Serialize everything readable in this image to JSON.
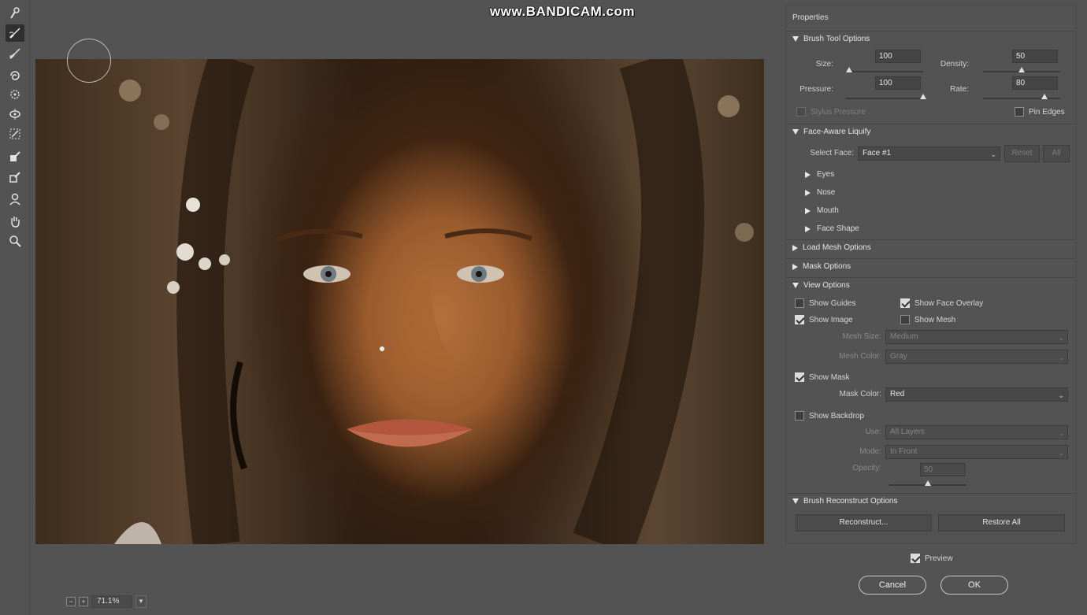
{
  "watermark": "www.BANDICAM.com",
  "toolbar": {
    "tools": [
      {
        "name": "forward-warp-icon",
        "active": false
      },
      {
        "name": "reconstruct-brush-icon",
        "active": true
      },
      {
        "name": "smooth-brush-icon",
        "active": false
      },
      {
        "name": "twirl-icon",
        "active": false
      },
      {
        "name": "pucker-icon",
        "active": false
      },
      {
        "name": "bloat-icon",
        "active": false
      },
      {
        "name": "push-left-icon",
        "active": false
      },
      {
        "name": "freeze-mask-icon",
        "active": false
      },
      {
        "name": "thaw-mask-icon",
        "active": false
      },
      {
        "name": "face-tool-icon",
        "active": false
      },
      {
        "name": "hand-icon",
        "active": false
      },
      {
        "name": "zoom-icon",
        "active": false
      }
    ]
  },
  "zoom": {
    "value": "71.1%"
  },
  "panel": {
    "title": "Properties",
    "brush_tool": {
      "heading": "Brush Tool Options",
      "size_label": "Size:",
      "size_value": "100",
      "size_level": 0.04,
      "density_label": "Density:",
      "density_value": "50",
      "density_level": 0.5,
      "pressure_label": "Pressure:",
      "pressure_value": "100",
      "pressure_level": 1.0,
      "rate_label": "Rate:",
      "rate_value": "80",
      "rate_level": 0.8,
      "stylus_label": "Stylus Pressure",
      "pin_edges_label": "Pin Edges"
    },
    "face_aware": {
      "heading": "Face-Aware Liquify",
      "select_face_label": "Select Face:",
      "select_face_value": "Face #1",
      "reset_label": "Reset",
      "all_label": "All",
      "items": [
        "Eyes",
        "Nose",
        "Mouth",
        "Face Shape"
      ]
    },
    "load_mesh_heading": "Load Mesh Options",
    "mask_heading": "Mask Options",
    "view": {
      "heading": "View Options",
      "show_guides": "Show Guides",
      "show_face_overlay": "Show Face Overlay",
      "show_image": "Show Image",
      "show_mesh": "Show Mesh",
      "mesh_size_label": "Mesh Size:",
      "mesh_size_value": "Medium",
      "mesh_color_label": "Mesh Color:",
      "mesh_color_value": "Gray",
      "show_mask": "Show Mask",
      "mask_color_label": "Mask Color:",
      "mask_color_value": "Red",
      "show_backdrop": "Show Backdrop",
      "use_label": "Use:",
      "use_value": "All Layers",
      "mode_label": "Mode:",
      "mode_value": "In Front",
      "opacity_label": "Opacity:",
      "opacity_value": "50",
      "opacity_level": 0.5
    },
    "reconstruct": {
      "heading": "Brush Reconstruct Options",
      "reconstruct_label": "Reconstruct...",
      "restore_all_label": "Restore All"
    }
  },
  "footer": {
    "preview_label": "Preview",
    "cancel_label": "Cancel",
    "ok_label": "OK"
  }
}
